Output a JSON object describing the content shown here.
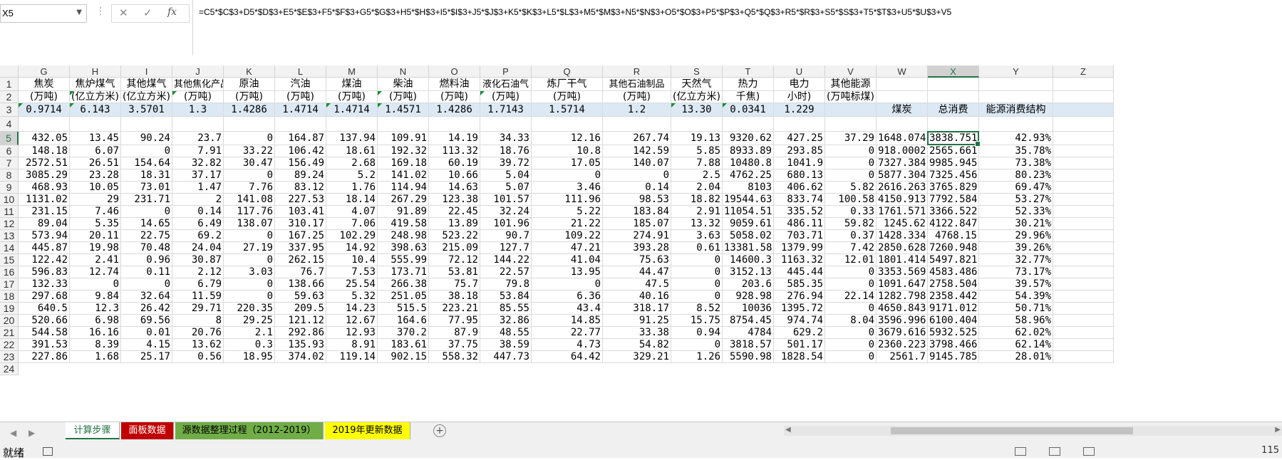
{
  "formula_bar": {
    "name_box": "X5",
    "cancel_icon": "✕",
    "enter_icon": "✓",
    "fx_icon": "fx",
    "formula": "=C5*$C$3+D5*$D$3+E5*$E$3+F5*$F$3+G5*$G$3+H5*$H$3+I5*$I$3+J5*$J$3+K5*$K$3+L5*$L$3+M5*$M$3+N5*$N$3+O5*$O$3+P5*$P$3+Q5*$Q$3+R5*$R$3+S5*$S$3+T5*$T$3+U5*$U$3+V5"
  },
  "columns": [
    "G",
    "H",
    "I",
    "J",
    "K",
    "L",
    "M",
    "N",
    "O",
    "P",
    "Q",
    "R",
    "S",
    "T",
    "U",
    "V",
    "W",
    "X",
    "Y",
    "Z"
  ],
  "selected_column": "X",
  "row_numbers": [
    "1",
    "2",
    "3",
    "4",
    "5",
    "6",
    "7",
    "8",
    "9",
    "10",
    "11",
    "12",
    "13",
    "14",
    "15",
    "16",
    "17",
    "18",
    "19",
    "20",
    "21",
    "22",
    "23",
    "24"
  ],
  "selected_row": "5",
  "header_row1": [
    "焦炭",
    "焦炉煤气",
    "其他煤气",
    "其他焦化产品",
    "原油",
    "汽油",
    "煤油",
    "柴油",
    "燃料油",
    "液化石油气",
    "炼厂干气",
    "其他石油制品",
    "天然气",
    "热力",
    "电力",
    "其他能源",
    "",
    "",
    "",
    ""
  ],
  "header_row2": [
    "(万吨)",
    "(亿立方米)",
    "(亿立方米)",
    "(万吨)",
    "(万吨)",
    "(万吨)",
    "(万吨)",
    "(万吨)",
    "(万吨)",
    "(万吨)",
    "(万吨)",
    "(万吨)",
    "(亿立方米)",
    "千焦)",
    "小时)",
    "(万吨标煤)",
    "",
    "",
    "",
    ""
  ],
  "coef_row": [
    "0.9714",
    "6.143",
    "3.5701",
    "1.3",
    "1.4286",
    "1.4714",
    "1.4714",
    "1.4571",
    "1.4286",
    "1.7143",
    "1.5714",
    "1.2",
    "13.30",
    "0.0341",
    "1.229",
    "",
    "煤炭",
    "总消费",
    "能源消费结构",
    ""
  ],
  "data_rows": [
    [
      "432.05",
      "13.45",
      "90.24",
      "23.7",
      "0",
      "164.87",
      "137.94",
      "109.91",
      "14.19",
      "34.33",
      "12.16",
      "267.74",
      "19.13",
      "9320.62",
      "427.25",
      "37.29",
      "1648.074",
      "3838.751",
      "42.93%"
    ],
    [
      "148.18",
      "6.07",
      "0",
      "7.91",
      "33.22",
      "106.42",
      "18.61",
      "192.32",
      "113.32",
      "18.76",
      "10.8",
      "142.59",
      "5.85",
      "8933.89",
      "293.85",
      "0",
      "918.0002",
      "2565.661",
      "35.78%"
    ],
    [
      "2572.51",
      "26.51",
      "154.64",
      "32.82",
      "30.47",
      "156.49",
      "2.68",
      "169.18",
      "60.19",
      "39.72",
      "17.05",
      "140.07",
      "7.88",
      "10480.8",
      "1041.9",
      "0",
      "7327.384",
      "9985.945",
      "73.38%"
    ],
    [
      "3085.29",
      "23.28",
      "18.31",
      "37.17",
      "0",
      "89.24",
      "5.2",
      "141.02",
      "10.66",
      "5.04",
      "0",
      "0",
      "2.5",
      "4762.25",
      "680.13",
      "0",
      "5877.304",
      "7325.456",
      "80.23%"
    ],
    [
      "468.93",
      "10.05",
      "73.01",
      "1.47",
      "7.76",
      "83.12",
      "1.76",
      "114.94",
      "14.63",
      "5.07",
      "3.46",
      "0.14",
      "2.04",
      "8103",
      "406.62",
      "5.82",
      "2616.263",
      "3765.829",
      "69.47%"
    ],
    [
      "1131.02",
      "29",
      "231.71",
      "2",
      "141.08",
      "227.53",
      "18.14",
      "267.29",
      "123.38",
      "101.57",
      "111.96",
      "98.53",
      "18.82",
      "19544.63",
      "833.74",
      "100.58",
      "4150.913",
      "7792.584",
      "53.27%"
    ],
    [
      "231.15",
      "7.46",
      "0",
      "0.14",
      "117.76",
      "103.41",
      "4.07",
      "91.89",
      "22.45",
      "32.24",
      "5.22",
      "183.84",
      "2.91",
      "11054.51",
      "335.52",
      "0.33",
      "1761.571",
      "3366.522",
      "52.33%"
    ],
    [
      "89.04",
      "5.35",
      "14.65",
      "6.49",
      "138.07",
      "310.17",
      "7.06",
      "419.58",
      "13.89",
      "101.96",
      "21.22",
      "185.07",
      "13.32",
      "9059.61",
      "486.11",
      "59.82",
      "1245.62",
      "4122.847",
      "30.21%"
    ],
    [
      "573.94",
      "20.11",
      "22.75",
      "69.2",
      "0",
      "167.25",
      "102.29",
      "248.98",
      "523.22",
      "90.7",
      "109.22",
      "274.91",
      "3.63",
      "5058.02",
      "703.71",
      "0.37",
      "1428.334",
      "4768.15",
      "29.96%"
    ],
    [
      "445.87",
      "19.98",
      "70.48",
      "24.04",
      "27.19",
      "337.95",
      "14.92",
      "398.63",
      "215.09",
      "127.7",
      "47.21",
      "393.28",
      "0.61",
      "13381.58",
      "1379.99",
      "7.42",
      "2850.628",
      "7260.948",
      "39.26%"
    ],
    [
      "122.42",
      "2.41",
      "0.96",
      "30.87",
      "0",
      "262.15",
      "10.4",
      "555.99",
      "72.12",
      "144.22",
      "41.04",
      "75.63",
      "0",
      "14600.3",
      "1163.32",
      "12.01",
      "1801.414",
      "5497.821",
      "32.77%"
    ],
    [
      "596.83",
      "12.74",
      "0.11",
      "2.12",
      "3.03",
      "76.7",
      "7.53",
      "173.71",
      "53.81",
      "22.57",
      "13.95",
      "44.47",
      "0",
      "3152.13",
      "445.44",
      "0",
      "3353.569",
      "4583.486",
      "73.17%"
    ],
    [
      "132.33",
      "0",
      "0",
      "6.79",
      "0",
      "138.66",
      "25.54",
      "266.38",
      "75.7",
      "79.8",
      "0",
      "47.5",
      "0",
      "203.6",
      "585.35",
      "0",
      "1091.647",
      "2758.504",
      "39.57%"
    ],
    [
      "297.68",
      "9.84",
      "32.64",
      "11.59",
      "0",
      "59.63",
      "5.32",
      "251.05",
      "38.18",
      "53.84",
      "6.36",
      "40.16",
      "0",
      "928.98",
      "276.94",
      "22.14",
      "1282.798",
      "2358.442",
      "54.39%"
    ],
    [
      "640.5",
      "12.3",
      "26.42",
      "29.71",
      "220.35",
      "209.5",
      "14.23",
      "515.5",
      "223.21",
      "85.55",
      "43.4",
      "318.17",
      "8.52",
      "10036",
      "1395.72",
      "0",
      "4650.843",
      "9171.012",
      "50.71%"
    ],
    [
      "520.66",
      "6.98",
      "69.56",
      "8",
      "29.25",
      "121.12",
      "12.67",
      "164.6",
      "77.95",
      "32.86",
      "14.85",
      "91.25",
      "15.75",
      "8754.45",
      "974.74",
      "8.04",
      "3596.996",
      "6100.404",
      "58.96%"
    ],
    [
      "544.58",
      "16.16",
      "0.01",
      "20.76",
      "2.1",
      "292.86",
      "12.93",
      "370.2",
      "87.9",
      "48.55",
      "22.77",
      "33.38",
      "0.94",
      "4784",
      "629.2",
      "0",
      "3679.616",
      "5932.525",
      "62.02%"
    ],
    [
      "391.53",
      "8.39",
      "4.15",
      "13.62",
      "0.3",
      "135.93",
      "8.91",
      "183.61",
      "37.75",
      "38.59",
      "4.73",
      "54.82",
      "0",
      "3818.57",
      "501.17",
      "0",
      "2360.223",
      "3798.466",
      "62.14%"
    ],
    [
      "227.86",
      "1.68",
      "25.17",
      "0.56",
      "18.95",
      "374.02",
      "119.14",
      "902.15",
      "558.32",
      "447.73",
      "64.42",
      "329.21",
      "1.26",
      "5590.98",
      "1828.54",
      "0",
      "2561.7",
      "9145.785",
      "28.01%"
    ]
  ],
  "sheet_tabs": [
    {
      "label": "计算步骤",
      "bg": "#ffffff",
      "color": "#217346",
      "active": true
    },
    {
      "label": "面板数据",
      "bg": "#c00000",
      "color": "#ffffff",
      "active": false
    },
    {
      "label": "源数据整理过程（2012-2019）",
      "bg": "#70ad47",
      "color": "#000000",
      "active": false
    },
    {
      "label": "2019年更新数据",
      "bg": "#ffff00",
      "color": "#000000",
      "active": false
    }
  ],
  "add_sheet_icon": "+",
  "status": {
    "ready": "就绪",
    "zoom": "115"
  },
  "colors": {
    "accent": "#217346",
    "header_bg": "#f2f2f2",
    "coef_row_bg": "#dce9f5"
  }
}
